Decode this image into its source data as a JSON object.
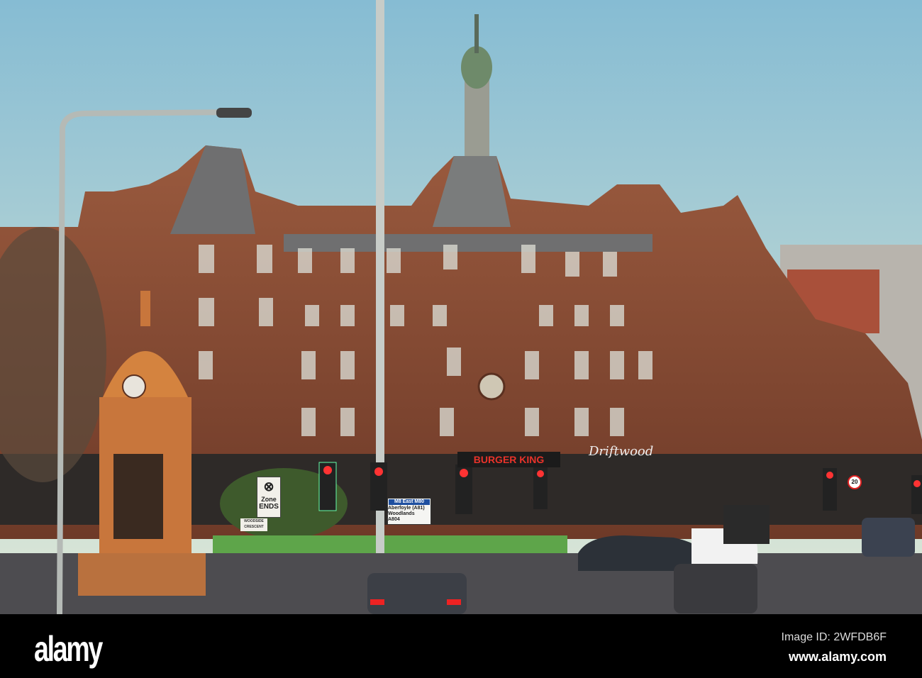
{
  "footer": {
    "logo": "alamy",
    "image_id": "Image ID: 2WFDB6F",
    "url": "www.alamy.com"
  },
  "scene_text": {
    "burger_king": "BURGER KING",
    "driftwood": "Driftwood",
    "zone_label": "Zone",
    "zone_ends": "ENDS",
    "street_sign": "WOODSIDE CRESCENT",
    "direction_top": "M8 East M80",
    "direction_line1": "Aberfoyle (A81)",
    "direction_line2": "Woodlands",
    "direction_line3": "A804",
    "speed_limit": "20"
  },
  "colors": {
    "sky_top": "#8fc1d6",
    "sky_bottom": "#d9e6d8",
    "sandstone": "#8a4a34",
    "burger_king_red": "#e8332a"
  }
}
